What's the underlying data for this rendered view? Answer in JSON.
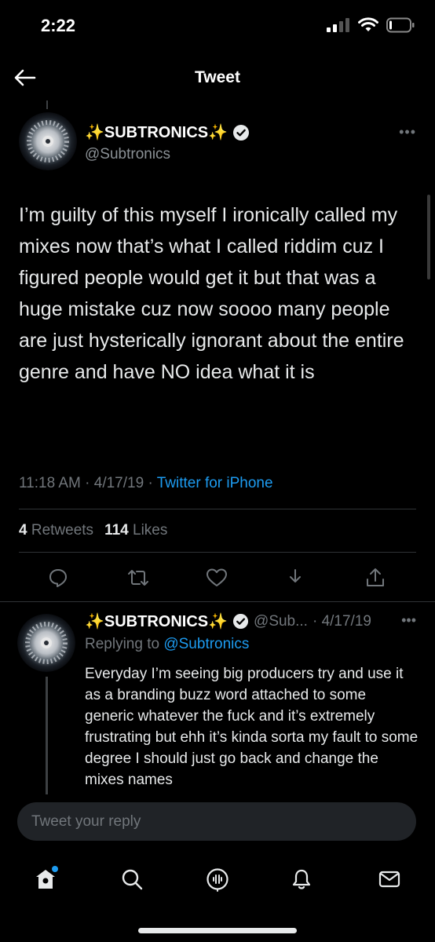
{
  "status_bar": {
    "time": "2:22"
  },
  "header": {
    "title": "Tweet"
  },
  "tweet": {
    "author_name": "✨SUBTRONICS✨",
    "handle": "@Subtronics",
    "text": "I’m guilty of this myself I ironically called my mixes now that’s what I called riddim cuz I figured people would get it but that was a huge mistake cuz now soooo many people are just hysterically ignorant about the entire genre and have NO idea what it is",
    "time": "11:18 AM",
    "separator": "·",
    "date": "4/17/19",
    "source": "Twitter for iPhone",
    "retweets_count": "4",
    "retweets_label": "Retweets",
    "likes_count": "114",
    "likes_label": "Likes"
  },
  "reply": {
    "author_name": "✨SUBTRONICS✨",
    "handle": "@Sub...",
    "date_prefix": "· 4/17/19",
    "replying_prefix": "Replying to",
    "replying_to": "@Subtronics",
    "text": "Everyday I’m seeing big producers try and use it as a branding buzz word attached to some generic whatever the fuck and it’s extremely frustrating but ehh it’s kinda sorta my fault to some degree I should just go back and change the mixes names"
  },
  "compose": {
    "placeholder": "Tweet your reply"
  },
  "colors": {
    "accent": "#1d9bf0",
    "background": "#000000",
    "muted": "#71767b",
    "text": "#e7e9ea"
  },
  "icons": {
    "actions": [
      "reply-icon",
      "retweet-icon",
      "like-icon",
      "bookmark-icon",
      "share-icon"
    ],
    "tabs": [
      "home-icon",
      "search-icon",
      "spaces-icon",
      "notifications-icon",
      "messages-icon"
    ]
  }
}
